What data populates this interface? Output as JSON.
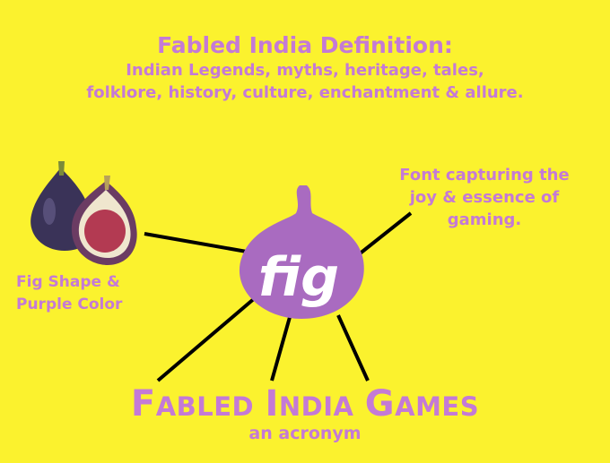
{
  "title": "Fabled India Definition:",
  "subtitle_line1": "Indian Legends, myths, heritage, tales,",
  "subtitle_line2": "folklore, history, culture, enchantment & allure.",
  "logo": {
    "text": "fig",
    "color": "#a96bc0"
  },
  "right_note": [
    "Font capturing the",
    "joy & essence of",
    "gaming."
  ],
  "left_note": [
    "Fig Shape &",
    "Purple Color"
  ],
  "acronym": {
    "words": [
      {
        "cap": "F",
        "rest": "ABLED"
      },
      {
        "cap": "I",
        "rest": "NDIA"
      },
      {
        "cap": "G",
        "rest": "AMES"
      }
    ],
    "caption": "an acronym"
  },
  "colors": {
    "background": "#fbf22e",
    "text": "#c47ad6",
    "lines": "#000000"
  },
  "icons": [
    "fig-fruit-illustration",
    "fig-logo"
  ]
}
